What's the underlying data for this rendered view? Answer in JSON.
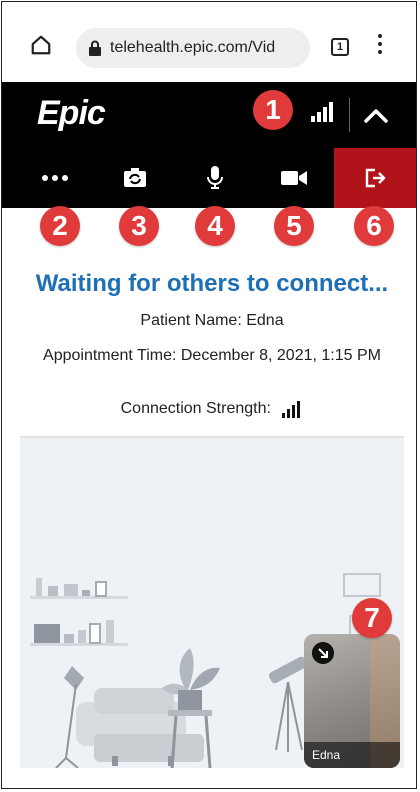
{
  "browser": {
    "url": "telehealth.epic.com/Vid",
    "tab_count": "1"
  },
  "header": {
    "logo_text": "Epic"
  },
  "controls": {
    "more_label": "More options",
    "camera_switch_label": "Switch camera",
    "mic_label": "Microphone",
    "video_label": "Camera",
    "leave_label": "Leave visit"
  },
  "callouts": [
    "1",
    "2",
    "3",
    "4",
    "5",
    "6",
    "7"
  ],
  "waiting": {
    "title": "Waiting for others to connect...",
    "patient_name": "Patient Name: Edna",
    "appointment_time": "Appointment Time: December 8, 2021, 1:15 PM",
    "connection_strength": "Connection Strength:"
  },
  "self_view": {
    "name": "Edna"
  },
  "colors": {
    "brand_bar": "#000000",
    "leave_button": "#b0141a",
    "callout": "#e03a3a",
    "title_blue": "#1f6fb5"
  }
}
